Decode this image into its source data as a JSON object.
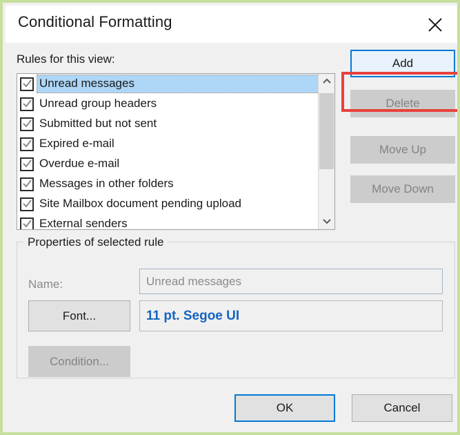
{
  "dialog": {
    "title": "Conditional Formatting",
    "close_icon": "close-icon"
  },
  "rules_section": {
    "label": "Rules for this view:",
    "items": [
      {
        "label": "Unread messages",
        "checked": true,
        "selected": true
      },
      {
        "label": "Unread group headers",
        "checked": true,
        "selected": false
      },
      {
        "label": "Submitted but not sent",
        "checked": true,
        "selected": false
      },
      {
        "label": "Expired e-mail",
        "checked": true,
        "selected": false
      },
      {
        "label": "Overdue e-mail",
        "checked": true,
        "selected": false
      },
      {
        "label": "Messages in other folders",
        "checked": true,
        "selected": false
      },
      {
        "label": "Site Mailbox document pending upload",
        "checked": true,
        "selected": false
      },
      {
        "label": "External senders",
        "checked": true,
        "selected": false
      }
    ],
    "scrollbar": {
      "up_icon": "chevron-up-icon",
      "down_icon": "chevron-down-icon"
    }
  },
  "side_buttons": {
    "add": "Add",
    "delete": "Delete",
    "move_up": "Move Up",
    "move_down": "Move Down"
  },
  "properties": {
    "legend": "Properties of selected rule",
    "name_label": "Name:",
    "name_value": "Unread messages",
    "font_button": "Font...",
    "font_value": "11 pt. Segoe UI",
    "condition_button": "Condition..."
  },
  "footer": {
    "ok": "OK",
    "cancel": "Cancel"
  },
  "colors": {
    "annotation_red": "#e8413c",
    "focus_blue": "#0078d7",
    "selection_blue": "#add6f7",
    "font_sample_blue": "#1565c0",
    "outer_frame_green": "#c6df9c"
  }
}
